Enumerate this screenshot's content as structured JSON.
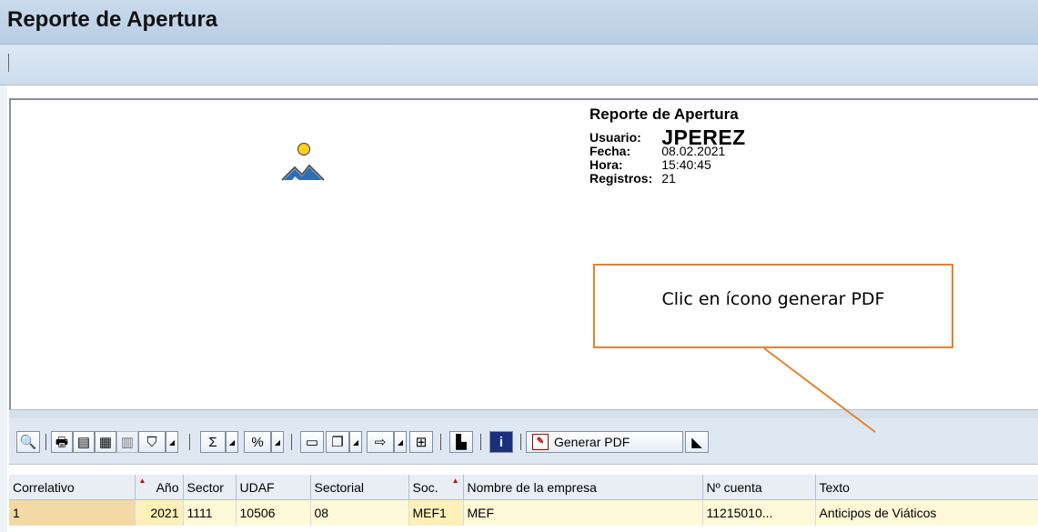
{
  "window": {
    "title": "Reporte de Apertura"
  },
  "header": {
    "report_title": "Reporte de Apertura",
    "labels": {
      "usuario": "Usuario:",
      "fecha": "Fecha:",
      "hora": "Hora:",
      "registros": "Registros:"
    },
    "values": {
      "usuario": "JPEREZ",
      "fecha": "08.02.2021",
      "hora": "15:40:45",
      "registros": "21"
    }
  },
  "callout": {
    "text": "Clic en ícono generar PDF",
    "border_color": "#e3832b"
  },
  "toolbar": {
    "icons": [
      "details-icon",
      "print-icon",
      "view-icon",
      "save-layout-icon",
      "layout-icon",
      "filter-icon",
      "sum-icon",
      "subtotal-icon",
      "print-preview-icon",
      "word-processing-icon",
      "export-icon",
      "spreadsheet-icon",
      "abc-analysis-icon",
      "info-icon",
      "pdf-icon",
      "graphic-icon"
    ],
    "generar_pdf_label": "Generar PDF"
  },
  "table": {
    "columns": [
      "Correlativo",
      "Año",
      "Sector",
      "UDAF",
      "Sectorial",
      "Soc.",
      "Nombre de la empresa",
      "Nº cuenta",
      "Texto"
    ],
    "rows": [
      [
        "1",
        "2021",
        "1111",
        "10506",
        "08",
        "MEF1",
        "MEF",
        "11215010...",
        "Anticipos de Viáticos"
      ]
    ]
  },
  "colors": {
    "title_bar": "#c9daec",
    "key_cell": "#f2d9a6",
    "row_bg": "#fff9d8",
    "sort_marker": "#cc0000"
  }
}
